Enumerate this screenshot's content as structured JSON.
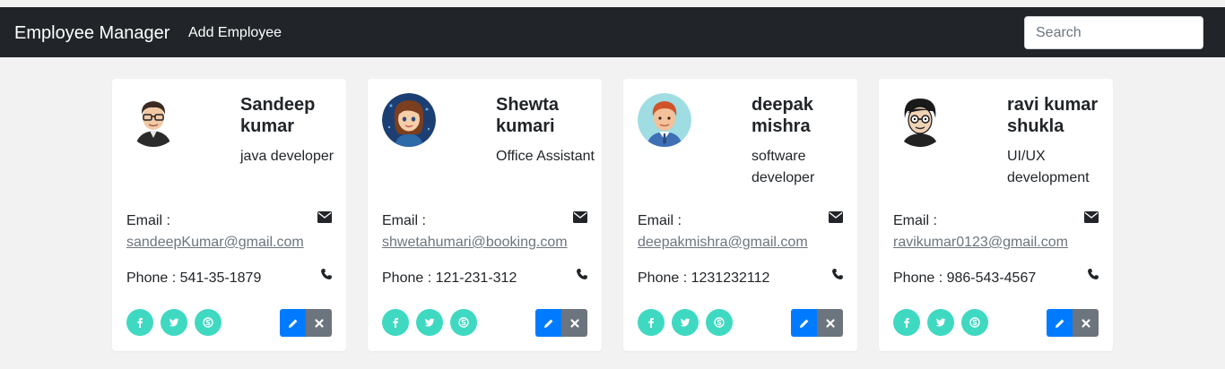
{
  "navbar": {
    "brand": "Employee Manager",
    "add_link": "Add Employee",
    "search_placeholder": "Search"
  },
  "labels": {
    "email": "Email :",
    "phone_prefix": "Phone : "
  },
  "colors": {
    "navbar_bg": "#212529",
    "social": "#3fd9c2",
    "edit": "#007bff",
    "delete": "#6c757d"
  },
  "employees": [
    {
      "name": "Sandeep kumar",
      "role": "java developer",
      "email": "sandeepKumar@gmail.com",
      "phone": "541-35-1879",
      "avatar": "boy-glasses-avatar"
    },
    {
      "name": "Shewta kumari",
      "role": "Office Assistant",
      "email": "shwetahumari@booking.com",
      "phone": "121-231-312",
      "avatar": "girl-avatar"
    },
    {
      "name": "deepak mishra",
      "role": "software developer",
      "email": "deepakmishra@gmail.com",
      "phone": "1231232112",
      "avatar": "man-redhair-avatar"
    },
    {
      "name": "ravi kumar shukla",
      "role": "UI/UX development",
      "email": "ravikumar0123@gmail.com",
      "phone": "986-543-4567",
      "avatar": "man-glasses-avatar"
    }
  ],
  "icons": {
    "email": "envelope-icon",
    "phone": "phone-icon",
    "social": [
      "facebook-icon",
      "twitter-icon",
      "skype-icon"
    ],
    "edit": "pencil-icon",
    "delete": "close-icon"
  }
}
